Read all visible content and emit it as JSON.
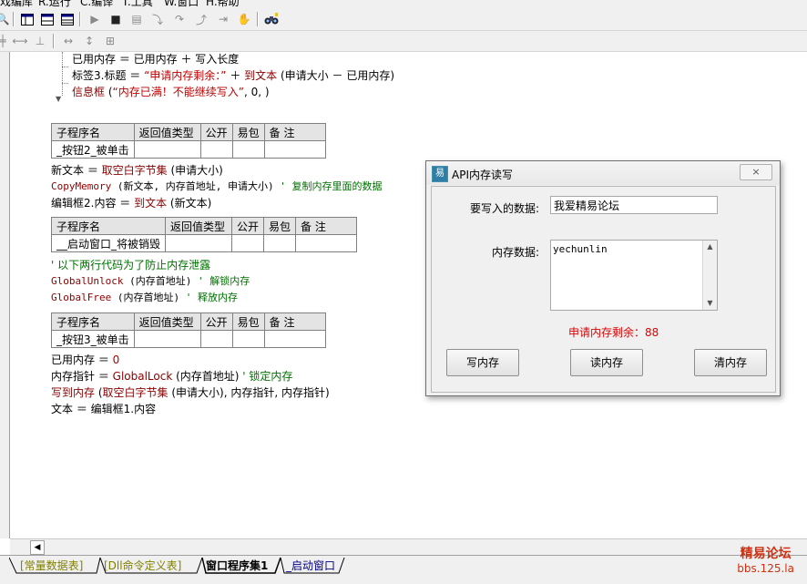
{
  "menu": {
    "items": [
      "戏编库",
      "R.运行",
      "C.编译",
      "T.工具",
      "W.窗口",
      "H.帮助"
    ]
  },
  "toolbar1": {
    "icons": [
      "tool-icon",
      "layout1-icon",
      "layout2-icon",
      "layout3-icon",
      "undo-icon",
      "run-icon",
      "stop-icon",
      "step-icon",
      "step-into-icon",
      "step-over-icon",
      "step-out-icon",
      "run-to-cursor-icon",
      "hand-icon",
      "binoculars-icon"
    ]
  },
  "toolbar2": {
    "icons": [
      "tool-icon",
      "align-left-icon",
      "align-center-icon",
      "align-right-icon",
      "width-icon",
      "height-icon",
      "size-icon"
    ]
  },
  "code": {
    "lines_top": [
      {
        "parts": [
          {
            "t": "已用内存 ＝ 已用内存 ＋ 写入长度",
            "c": ""
          }
        ]
      },
      {
        "parts": [
          {
            "t": "标签3.标题 ＝ ",
            "c": ""
          },
          {
            "t": "“申请内存剩余：”",
            "c": "str"
          },
          {
            "t": " ＋ ",
            "c": ""
          },
          {
            "t": "到文本",
            "c": "fn"
          },
          {
            "t": " (申请大小 － 已用内存)",
            "c": ""
          }
        ]
      },
      {
        "parts": [
          {
            "t": "信息框",
            "c": "fn"
          },
          {
            "t": " (",
            "c": ""
          },
          {
            "t": "“内存已满！不能继续写入”",
            "c": "str"
          },
          {
            "t": ", 0, )",
            "c": ""
          }
        ]
      }
    ],
    "sub_header": {
      "name": "子程序名",
      "ret": "返回值类型",
      "public": "公开",
      "easy": "易包",
      "note": "备 注"
    },
    "sub1": {
      "name": "_按钮2_被单击"
    },
    "block1": [
      {
        "parts": [
          {
            "t": "新文本 ＝ ",
            "c": ""
          },
          {
            "t": "取空白字节集",
            "c": "fn"
          },
          {
            "t": " (申请大小)",
            "c": ""
          }
        ]
      },
      {
        "mono": true,
        "parts": [
          {
            "t": "CopyMemory",
            "c": "api"
          },
          {
            "t": " (新文本, 内存首地址, 申请大小)",
            "c": ""
          },
          {
            "t": " ' 复制内存里面的数据",
            "c": "cmt"
          }
        ]
      },
      {
        "parts": [
          {
            "t": "编辑框2.内容 ＝ ",
            "c": ""
          },
          {
            "t": "到文本",
            "c": "fn"
          },
          {
            "t": " (新文本)",
            "c": ""
          }
        ]
      }
    ],
    "sub2": {
      "name": "__启动窗口_将被销毁"
    },
    "block2": [
      {
        "parts": [
          {
            "t": "' 以下两行代码为了防止内存泄露",
            "c": "cmt"
          }
        ]
      },
      {
        "mono": true,
        "parts": [
          {
            "t": "GlobalUnlock",
            "c": "api"
          },
          {
            "t": " (内存首地址)",
            "c": ""
          },
          {
            "t": " ' 解锁内存",
            "c": "cmt"
          }
        ]
      },
      {
        "mono": true,
        "parts": [
          {
            "t": "GlobalFree",
            "c": "api"
          },
          {
            "t": " (内存首地址)",
            "c": ""
          },
          {
            "t": " ' 释放内存",
            "c": "cmt"
          }
        ]
      }
    ],
    "sub3": {
      "name": "_按钮3_被单击"
    },
    "block3": [
      {
        "parts": [
          {
            "t": "已用内存 ＝ ",
            "c": ""
          },
          {
            "t": "0",
            "c": "str"
          }
        ]
      },
      {
        "parts": [
          {
            "t": "内存指针 ＝ ",
            "c": ""
          },
          {
            "t": "GlobalLock",
            "c": "api"
          },
          {
            "t": " (内存首地址)",
            "c": ""
          },
          {
            "t": " ' 锁定内存",
            "c": "cmt"
          }
        ]
      },
      {
        "parts": [
          {
            "t": "写到内存",
            "c": "fn"
          },
          {
            "t": " (",
            "c": ""
          },
          {
            "t": "取空白字节集",
            "c": "fn"
          },
          {
            "t": " (申请大小), 内存指针, 内存指针)",
            "c": ""
          }
        ]
      },
      {
        "parts": [
          {
            "t": "文本 ＝ 编辑框1.内容",
            "c": ""
          }
        ]
      }
    ]
  },
  "dialog": {
    "title": "API内存读写",
    "close_label": "×",
    "write_label": "要写入的数据:",
    "write_value": "我爱精易论坛",
    "memory_label": "内存数据:",
    "memory_value": "yechunlin",
    "status": "申请内存剩余：88",
    "btn_write": "写内存",
    "btn_read": "读内存",
    "btn_clear": "清内存"
  },
  "tabs": [
    {
      "label": "[常量数据表]"
    },
    {
      "label": "[Dll命令定义表]"
    },
    {
      "label": "窗口程序集1"
    },
    {
      "label": "_启动窗口"
    }
  ],
  "watermark": {
    "line1": "精易论坛",
    "line2": "bbs.125.la"
  },
  "colors": {
    "string": "#c00000",
    "comment": "#007000",
    "keyword": "#8b0000",
    "status": "#e00000"
  }
}
